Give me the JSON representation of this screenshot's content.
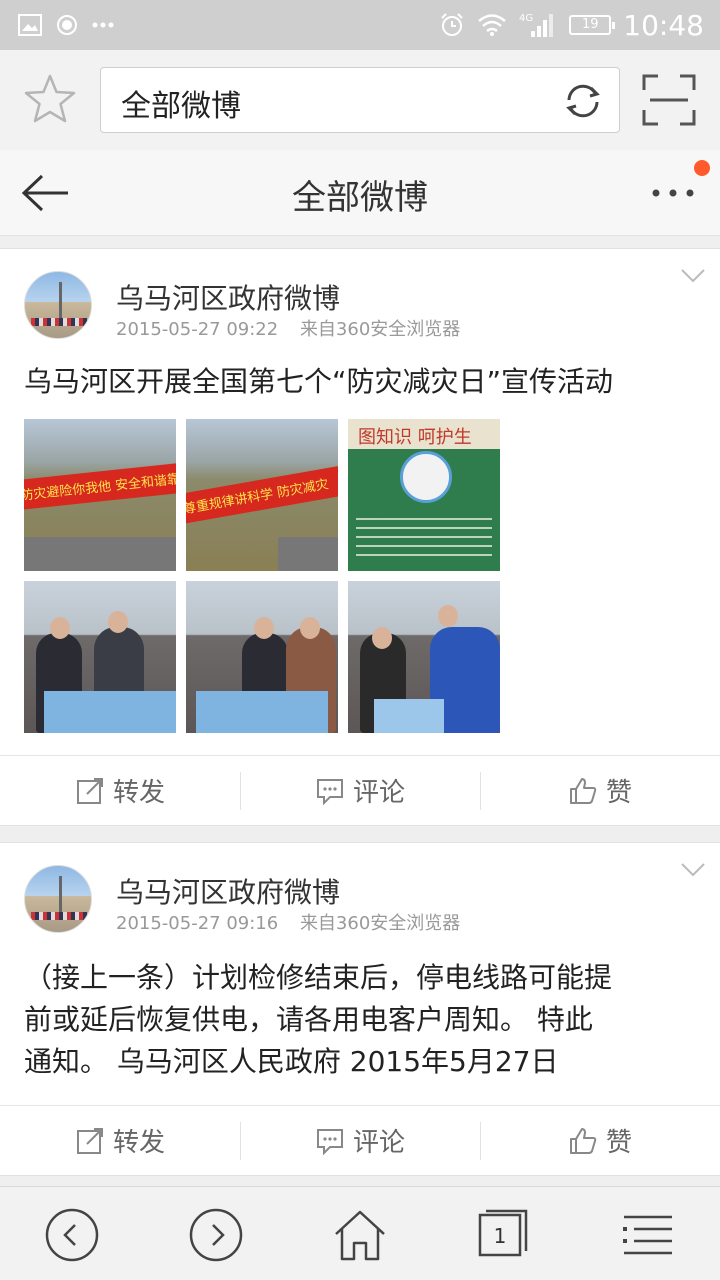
{
  "status_bar": {
    "time": "10:48",
    "battery": "19",
    "network": "4G"
  },
  "browser": {
    "url_text": "全部微博"
  },
  "header": {
    "title": "全部微博"
  },
  "posts": [
    {
      "author": "乌马河区政府微博",
      "time": "2015-05-27 09:22",
      "source": "来自360安全浏览器",
      "text": "乌马河区开展全国第七个“防灾减灾日”宣传活动",
      "images": [
        {
          "banner_text": "防灾避险你我他 安全和谐靠大家"
        },
        {
          "banner_text": "尊重规律讲科学 防灾减灾"
        },
        {
          "banner_text": "图知识 呵护生"
        },
        {
          "banner_text": ""
        },
        {
          "banner_text": ""
        },
        {
          "banner_text": ""
        }
      ],
      "actions": {
        "repost": "转发",
        "comment": "评论",
        "like": "赞"
      }
    },
    {
      "author": "乌马河区政府微博",
      "time": "2015-05-27 09:16",
      "source": "来自360安全浏览器",
      "text_lines": [
        "（接上一条）计划检修结束后，停电线路可能提",
        "前或延后恢复供电，请各用电客户周知。 特此",
        "通知。 乌马河区人民政府 2015年5月27日"
      ],
      "actions": {
        "repost": "转发",
        "comment": "评论",
        "like": "赞"
      }
    }
  ],
  "bottom_bar": {
    "tab_count": "1"
  },
  "colors": {
    "notification_dot": "#ff5a2c",
    "status_bar": "#cfcfcf"
  }
}
